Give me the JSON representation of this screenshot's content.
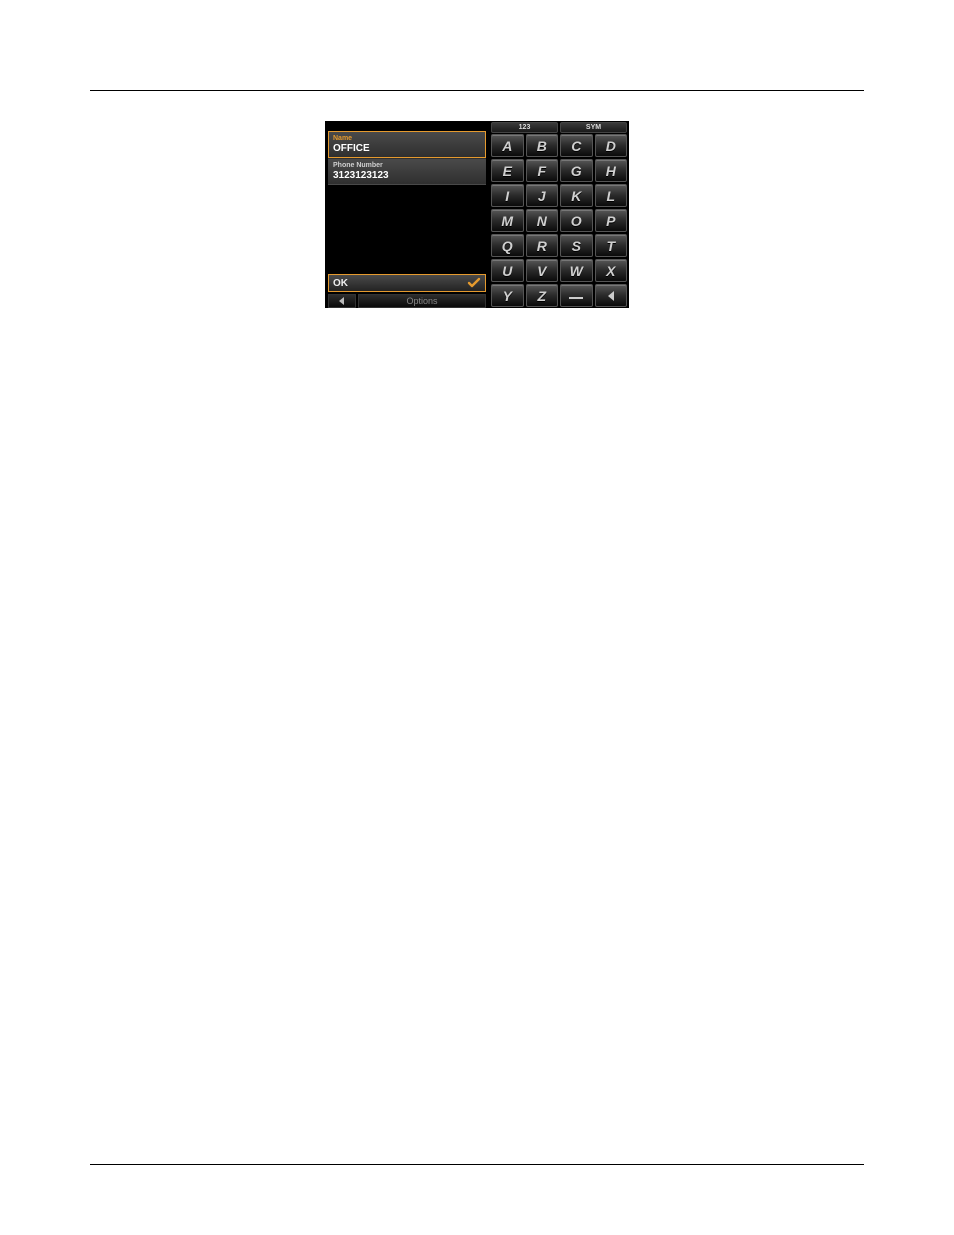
{
  "device": {
    "fields": {
      "name": {
        "label": "Name",
        "value": "OFFICE"
      },
      "phone": {
        "label": "Phone Number",
        "value": "3123123123"
      }
    },
    "ok_label": "OK",
    "options_label": "Options",
    "keyboard": {
      "modes": [
        "123",
        "SYM"
      ],
      "keys": [
        "A",
        "B",
        "C",
        "D",
        "E",
        "F",
        "G",
        "H",
        "I",
        "J",
        "K",
        "L",
        "M",
        "N",
        "O",
        "P",
        "Q",
        "R",
        "S",
        "T",
        "U",
        "V",
        "W",
        "X",
        "Y",
        "Z",
        "_",
        "BKSP"
      ]
    }
  }
}
